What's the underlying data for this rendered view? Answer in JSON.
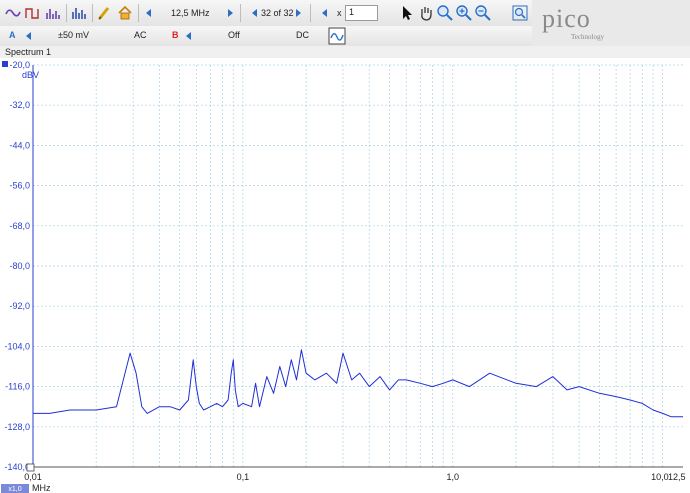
{
  "toolbar": {
    "timebase": "12,5 MHz",
    "buffer": "32 of 32",
    "zoom_x_label": "x",
    "zoom_x_value": "1"
  },
  "channel_a": {
    "name": "A",
    "range": "±50 mV",
    "coupling": "AC",
    "color": "#2a6fc4"
  },
  "channel_b": {
    "name": "B",
    "range": "Off",
    "coupling": "DC",
    "color": "#e02020"
  },
  "brand": {
    "name": "pico",
    "sub": "Technology"
  },
  "view": {
    "tab": "Spectrum 1"
  },
  "chart_data": {
    "type": "line",
    "y_unit": "dBV",
    "x_unit": "MHz",
    "x_scale": "log",
    "xlim": [
      0.01,
      12.5
    ],
    "ylim": [
      -140,
      -20
    ],
    "grid": true,
    "line_color": "#1f2fd6",
    "y_ticks": [
      "-20,0",
      "-32,0",
      "-44,0",
      "-56,0",
      "-68,0",
      "-80,0",
      "-92,0",
      "-104,0",
      "-116,0",
      "-128,0",
      "-140,0"
    ],
    "x_ticks": [
      {
        "v": 0.01,
        "label": "0,01"
      },
      {
        "v": 0.1,
        "label": "0,1"
      },
      {
        "v": 1.0,
        "label": "1,0"
      },
      {
        "v": 10.0,
        "label": "10,0"
      },
      {
        "v": 12.5,
        "label": "12,5"
      }
    ],
    "zoom_badge": "x1,0",
    "series": [
      {
        "x": [
          0.01,
          0.012,
          0.015,
          0.02,
          0.025,
          0.029,
          0.031,
          0.033,
          0.035,
          0.04,
          0.045,
          0.05,
          0.055,
          0.058,
          0.06,
          0.062,
          0.065,
          0.07,
          0.075,
          0.08,
          0.085,
          0.088,
          0.09,
          0.092,
          0.095,
          0.1,
          0.11,
          0.115,
          0.12,
          0.13,
          0.14,
          0.15,
          0.16,
          0.17,
          0.18,
          0.19,
          0.2,
          0.22,
          0.25,
          0.28,
          0.3,
          0.33,
          0.36,
          0.4,
          0.45,
          0.5,
          0.55,
          0.6,
          0.7,
          0.8,
          0.9,
          1.0,
          1.2,
          1.5,
          2.0,
          2.5,
          3.0,
          3.5,
          4.0,
          5.0,
          6.0,
          7.0,
          8.0,
          9.0,
          10.0,
          11.0,
          12.5
        ],
        "y": [
          -124,
          -124,
          -123,
          -123,
          -122,
          -106,
          -112,
          -122,
          -124,
          -122,
          -122,
          -123,
          -120,
          -108,
          -116,
          -121,
          -123,
          -122,
          -121,
          -122,
          -120,
          -112,
          -108,
          -117,
          -122,
          -121,
          -122,
          -115,
          -122,
          -113,
          -118,
          -110,
          -116,
          -108,
          -114,
          -105,
          -112,
          -114,
          -112,
          -115,
          -106,
          -114,
          -112,
          -116,
          -113,
          -117,
          -114,
          -114,
          -115,
          -116,
          -115,
          -114,
          -116,
          -112,
          -115,
          -116,
          -113,
          -117,
          -116,
          -118,
          -119,
          -120,
          -121,
          -123,
          -124,
          -125,
          -125
        ]
      }
    ]
  }
}
